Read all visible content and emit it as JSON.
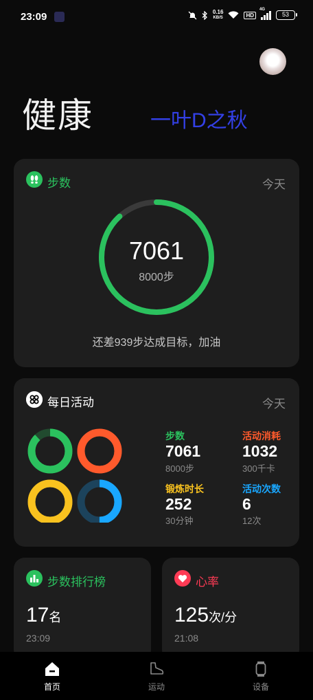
{
  "status_bar": {
    "time": "23:09",
    "net_speed_value": "0.16",
    "net_speed_unit": "KB/S",
    "hd": "HD",
    "network": "4G",
    "battery": "53",
    "icons": [
      "app-notification-icon",
      "mute-bell-icon",
      "bluetooth-icon",
      "wifi-icon",
      "signal-icon",
      "battery-icon"
    ]
  },
  "header": {
    "title": "健康",
    "watermark": "一叶D之秋",
    "avatar": "user-avatar"
  },
  "steps_card": {
    "title": "步数",
    "period": "今天",
    "value": "7061",
    "goal_label": "8000步",
    "steps": 7061,
    "goal": 8000,
    "message": "还差939步达成目标，加油",
    "color": "#2bc15e"
  },
  "activity_card": {
    "title": "每日活动",
    "period": "今天",
    "stats": [
      {
        "label": "步数",
        "value": "7061",
        "sub": "8000步",
        "color": "#2bc15e",
        "progress": 0.88
      },
      {
        "label": "活动消耗",
        "value": "1032",
        "sub": "300千卡",
        "color": "#ff5a2c",
        "progress": 1.0
      },
      {
        "label": "锻炼时长",
        "value": "252",
        "sub": "30分钟",
        "color": "#f9c21f",
        "progress": 1.0
      },
      {
        "label": "活动次数",
        "value": "6",
        "sub": "12次",
        "color": "#19a7ff",
        "progress": 0.5
      }
    ]
  },
  "rank_card": {
    "title": "步数排行榜",
    "value": "17",
    "unit": "名",
    "time": "23:09",
    "color": "#2bc15e"
  },
  "heart_card": {
    "title": "心率",
    "value": "125",
    "unit": "次/分",
    "time": "21:08",
    "color": "#ff3b55"
  },
  "tabs": [
    {
      "label": "首页",
      "icon": "home-icon",
      "active": true
    },
    {
      "label": "运动",
      "icon": "shoe-icon",
      "active": false
    },
    {
      "label": "设备",
      "icon": "watch-icon",
      "active": false
    }
  ]
}
